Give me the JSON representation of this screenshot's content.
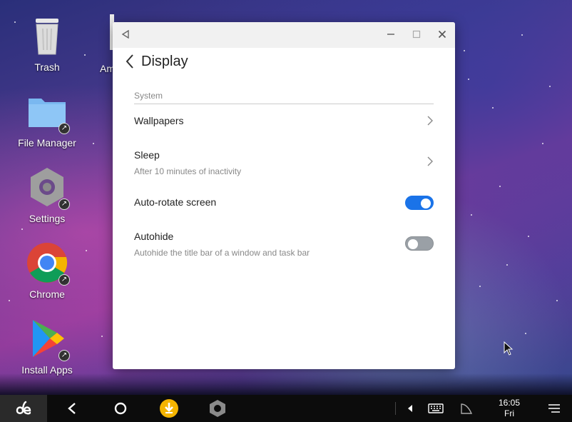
{
  "desktop": {
    "icons": [
      {
        "label": "Trash",
        "icon": "trash-icon"
      },
      {
        "label": "File Manager",
        "icon": "folder-icon"
      },
      {
        "label": "Settings",
        "icon": "settings-gear-icon"
      },
      {
        "label": "Chrome",
        "icon": "chrome-icon"
      },
      {
        "label": "Install Apps",
        "icon": "play-store-icon"
      }
    ],
    "partial_label": "Am"
  },
  "window": {
    "title": "Display",
    "section": "System",
    "rows": {
      "wallpapers": {
        "title": "Wallpapers"
      },
      "sleep": {
        "title": "Sleep",
        "subtitle": "After 10 minutes of inactivity"
      },
      "autorotate": {
        "title": "Auto-rotate screen",
        "enabled": true
      },
      "autohide": {
        "title": "Autohide",
        "subtitle": "Autohide the title bar of a window and task bar",
        "enabled": false
      }
    }
  },
  "taskbar": {
    "time": "16:05",
    "day": "Fri"
  },
  "colors": {
    "toggle_on": "#1a73e8",
    "toggle_off": "#9aa0a6",
    "download_badge": "#f4b400"
  }
}
